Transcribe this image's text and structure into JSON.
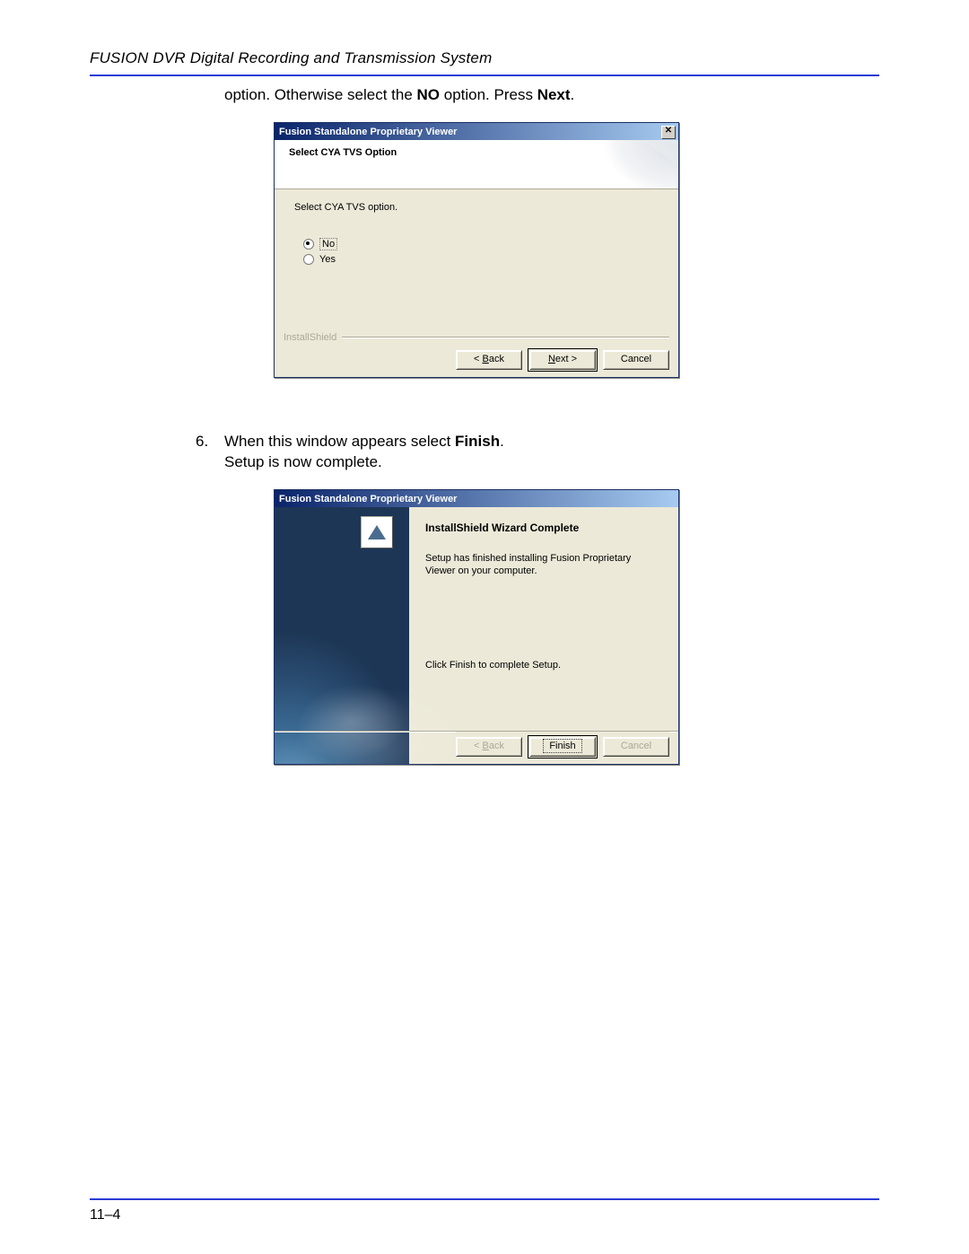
{
  "doc": {
    "header_title": "FUSION DVR Digital Recording and Transmission System",
    "page_number": "11–4",
    "line1_pre": "option. Otherwise select the ",
    "line1_bold1": "NO",
    "line1_mid": " option. Press ",
    "line1_bold2": "Next",
    "line1_post": ".",
    "step6_num": "6.",
    "step6_line1_pre": "When this window appears select ",
    "step6_line1_bold": "Finish",
    "step6_line1_post": ".",
    "step6_line2": "Setup is now complete."
  },
  "dlg1": {
    "title": "Fusion Standalone Proprietary Viewer",
    "close_glyph": "✕",
    "subtitle": "Select CYA TVS Option",
    "prompt": "Select CYA TVS option.",
    "opt_no": "No",
    "opt_yes": "Yes",
    "brand": "InstallShield",
    "btn_back_pre": "< ",
    "btn_back_ul": "B",
    "btn_back_post": "ack",
    "btn_next_ul": "N",
    "btn_next_post": "ext >",
    "btn_cancel": "Cancel"
  },
  "dlg2": {
    "title": "Fusion Standalone Proprietary Viewer",
    "heading": "InstallShield Wizard Complete",
    "body": "Setup has finished installing Fusion Proprietary Viewer on your computer.",
    "body2": "Click Finish to complete Setup.",
    "btn_back_pre": "< ",
    "btn_back_ul": "B",
    "btn_back_post": "ack",
    "btn_finish": "Finish",
    "btn_cancel": "Cancel"
  }
}
